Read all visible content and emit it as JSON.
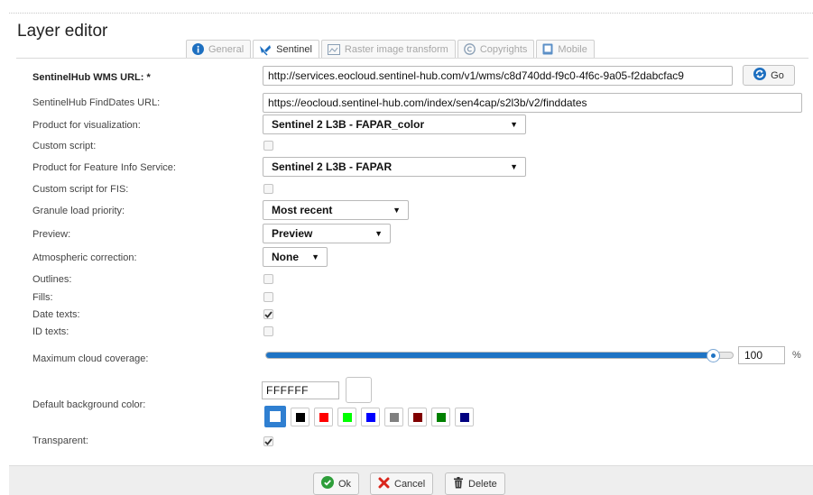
{
  "window": {
    "title": "Layer editor"
  },
  "tabs": [
    {
      "label": "General",
      "icon": "info-circle-icon",
      "active": false
    },
    {
      "label": "Sentinel",
      "icon": "satellite-icon",
      "active": true
    },
    {
      "label": "Raster image transform",
      "icon": "raster-transform-icon",
      "active": false
    },
    {
      "label": "Copyrights",
      "icon": "copyright-icon",
      "active": false
    },
    {
      "label": "Mobile",
      "icon": "mobile-icon",
      "active": false
    }
  ],
  "form": {
    "wms_url": {
      "label": "SentinelHub WMS URL: *",
      "value": "http://services.eocloud.sentinel-hub.com/v1/wms/c8d740dd-f9c0-4f6c-9a05-f2dabcfac9"
    },
    "go_button": "Go",
    "finddates_url": {
      "label": "SentinelHub FindDates URL:",
      "value": "https://eocloud.sentinel-hub.com/index/sen4cap/s2l3b/v2/finddates"
    },
    "product_vis": {
      "label": "Product for visualization:",
      "value": "Sentinel 2 L3B - FAPAR_color"
    },
    "custom_script": {
      "label": "Custom script:",
      "checked": false
    },
    "product_fis": {
      "label": "Product for Feature Info Service:",
      "value": "Sentinel 2 L3B - FAPAR"
    },
    "custom_script_fis": {
      "label": "Custom script for FIS:",
      "checked": false
    },
    "granule_priority": {
      "label": "Granule load priority:",
      "value": "Most recent"
    },
    "preview": {
      "label": "Preview:",
      "value": "Preview"
    },
    "atmospheric": {
      "label": "Atmospheric correction:",
      "value": "None"
    },
    "outlines": {
      "label": "Outlines:",
      "checked": false
    },
    "fills": {
      "label": "Fills:",
      "checked": false
    },
    "date_texts": {
      "label": "Date texts:",
      "checked": true
    },
    "id_texts": {
      "label": "ID texts:",
      "checked": false
    },
    "cloud_coverage": {
      "label": "Maximum cloud coverage:",
      "value": "100",
      "unit": "%",
      "level_percent": 100
    },
    "bg_color": {
      "label": "Default background color:",
      "value": "FFFFFF",
      "swatches": [
        "#ffffff",
        "#000000",
        "#ff0000",
        "#00ff00",
        "#0000ff",
        "#808080",
        "#800000",
        "#008000",
        "#000080"
      ],
      "selected_index": 0
    },
    "transparent": {
      "label": "Transparent:",
      "checked": true
    }
  },
  "footer": {
    "ok": "Ok",
    "cancel": "Cancel",
    "delete": "Delete"
  },
  "colors": {
    "accent": "#1e73c4",
    "ok_green": "#2e9e3a",
    "cancel_red": "#d9261c",
    "go_blue": "#1d6fc0"
  }
}
